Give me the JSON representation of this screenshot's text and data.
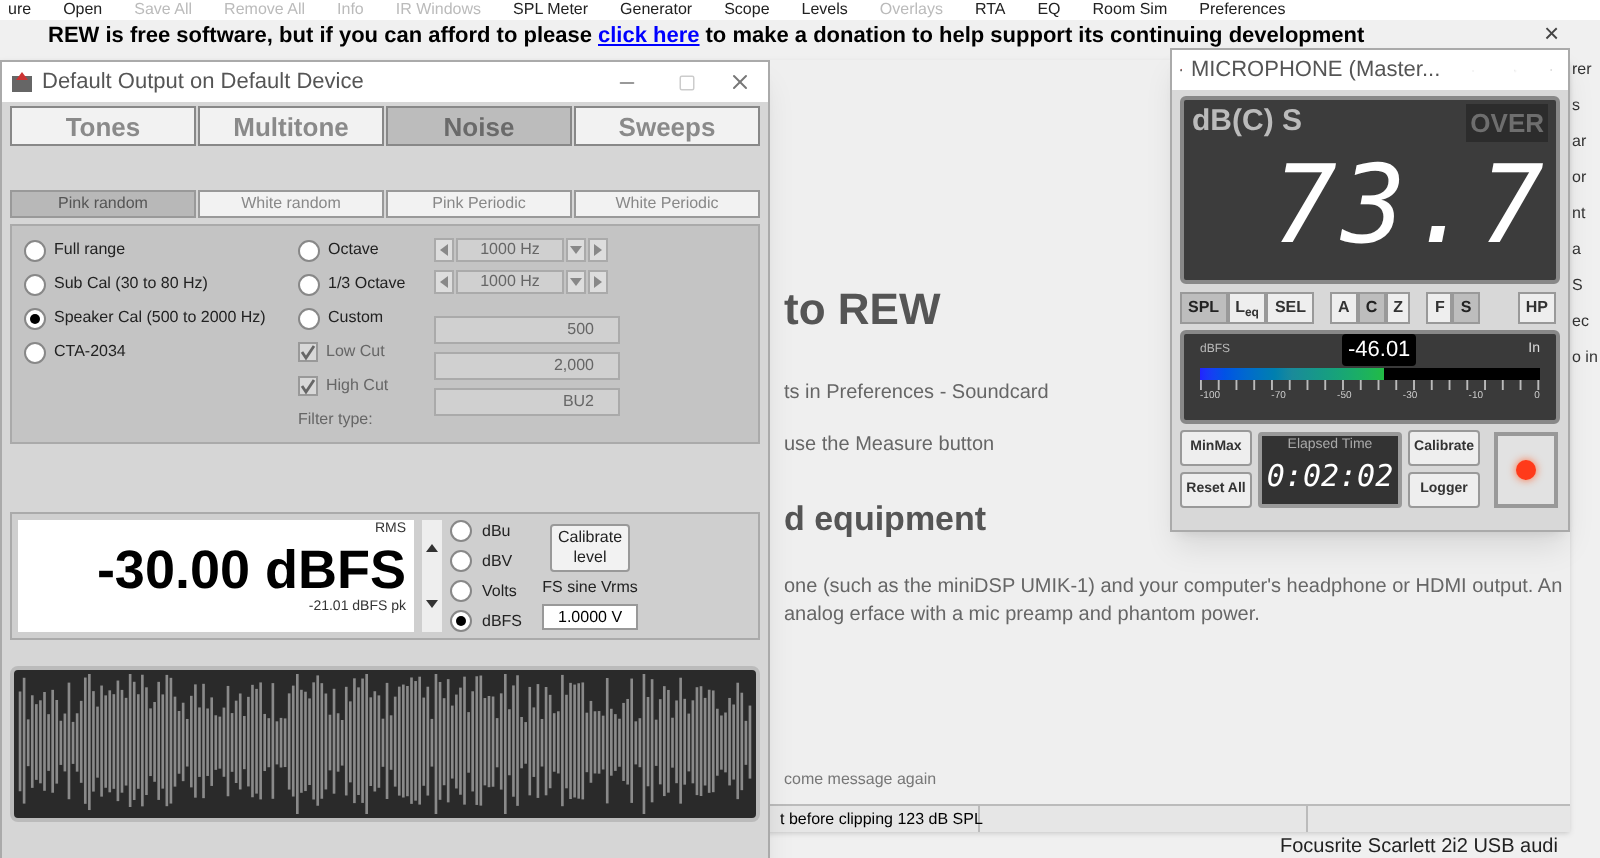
{
  "toolbar": [
    {
      "label": "ure",
      "disabled": false
    },
    {
      "label": "Open",
      "disabled": false
    },
    {
      "label": "Save All",
      "disabled": true
    },
    {
      "label": "Remove All",
      "disabled": true
    },
    {
      "label": "Info",
      "disabled": true
    },
    {
      "label": "IR Windows",
      "disabled": true
    },
    {
      "label": "SPL Meter",
      "disabled": false
    },
    {
      "label": "Generator",
      "disabled": false
    },
    {
      "label": "Scope",
      "disabled": false
    },
    {
      "label": "Levels",
      "disabled": false
    },
    {
      "label": "Overlays",
      "disabled": true
    },
    {
      "label": "RTA",
      "disabled": false
    },
    {
      "label": "EQ",
      "disabled": false
    },
    {
      "label": "Room Sim",
      "disabled": false
    },
    {
      "label": "Preferences",
      "disabled": false
    }
  ],
  "banner": {
    "text_before": "REW is free software, but if you can afford to please",
    "link": "click here",
    "text_after": "to make a donation to help support its continuing development",
    "close": "×"
  },
  "main_window": {
    "heading_1": "to REW",
    "line_1": "ts in Preferences - Soundcard",
    "line_2": "use the Measure button",
    "heading_2": "d equipment",
    "paragraph": "one (such as the miniDSP UMIK-1) and your computer's headphone or HDMI output. An analog erface with a mic preamp and phantom power.",
    "footer_text": "come message again",
    "status_text": "t before clipping 123 dB SPL"
  },
  "background_fragments": [
    "rer",
    "s",
    "ar",
    "or",
    "nt",
    "a",
    "S",
    "ec",
    "o in"
  ],
  "background_label": "Focusrite Scarlett 2i2 USB audi",
  "generator": {
    "title": "Default Output on Default Device",
    "tabs": [
      {
        "label": "Tones",
        "selected": false
      },
      {
        "label": "Multitone",
        "selected": false
      },
      {
        "label": "Noise",
        "selected": true
      },
      {
        "label": "Sweeps",
        "selected": false
      }
    ],
    "subtabs": [
      {
        "label": "Pink random",
        "selected": true
      },
      {
        "label": "White random",
        "selected": false
      },
      {
        "label": "Pink Periodic",
        "selected": false
      },
      {
        "label": "White Periodic",
        "selected": false
      }
    ],
    "range_options": [
      {
        "label": "Full range",
        "selected": false
      },
      {
        "label": "Sub Cal (30 to 80 Hz)",
        "selected": false
      },
      {
        "label": "Speaker Cal (500 to 2000 Hz)",
        "selected": true
      },
      {
        "label": "CTA-2034",
        "selected": false
      }
    ],
    "band_options": [
      {
        "label": "Octave",
        "selected": false
      },
      {
        "label": "1/3 Octave",
        "selected": false
      },
      {
        "label": "Custom",
        "selected": false
      }
    ],
    "frequency_spinners": [
      {
        "value": "1000 Hz",
        "disabled": true
      },
      {
        "value": "1000 Hz",
        "disabled": true
      }
    ],
    "cut_filters": [
      {
        "label": "Low Cut",
        "checked": true,
        "disabled": true,
        "value": "500"
      },
      {
        "label": "High Cut",
        "checked": true,
        "disabled": true,
        "value": "2,000"
      }
    ],
    "filter_type": {
      "label": "Filter type:",
      "value": "BU2",
      "disabled": true
    },
    "level": {
      "mode": "RMS",
      "reading": "-30.00 dBFS",
      "peak": "-21.01 dBFS pk",
      "calibrate_button": "Calibrate level",
      "fs_label": "FS sine Vrms",
      "fs_value": "1.0000 V",
      "units": [
        {
          "label": "dBu",
          "selected": false
        },
        {
          "label": "dBV",
          "selected": false
        },
        {
          "label": "Volts",
          "selected": false
        },
        {
          "label": "dBFS",
          "selected": true
        }
      ]
    }
  },
  "microphone": {
    "title": "MICROPHONE (Master...",
    "weighting_label": "dB(C) S",
    "over": {
      "label": "OVER",
      "on": false
    },
    "reading": "73.7",
    "mode_buttons": [
      {
        "label": "SPL",
        "selected": true
      },
      {
        "label": "L$_{eq}$",
        "selected": false
      },
      {
        "label": "SEL",
        "selected": false
      }
    ],
    "weighting_buttons": [
      {
        "label": "A",
        "selected": false
      },
      {
        "label": "C",
        "selected": true
      },
      {
        "label": "Z",
        "selected": false
      }
    ],
    "time_buttons": [
      {
        "label": "F",
        "selected": false
      },
      {
        "label": "S",
        "selected": true
      }
    ],
    "hp_button": {
      "label": "HP",
      "selected": false
    },
    "meter": {
      "unit": "dBFS",
      "reading": "-46.01",
      "input": "In",
      "level": 0.54,
      "ticks": [
        "-100",
        "-70",
        "-50",
        "-30",
        "-10",
        "0"
      ]
    },
    "minmax_button": "MinMax",
    "reset_button": "Reset All",
    "elapsed_label": "Elapsed Time",
    "elapsed": "0:02:02",
    "calibrate_button": "Calibrate",
    "logger_button": "Logger",
    "record": {
      "on": true
    }
  }
}
